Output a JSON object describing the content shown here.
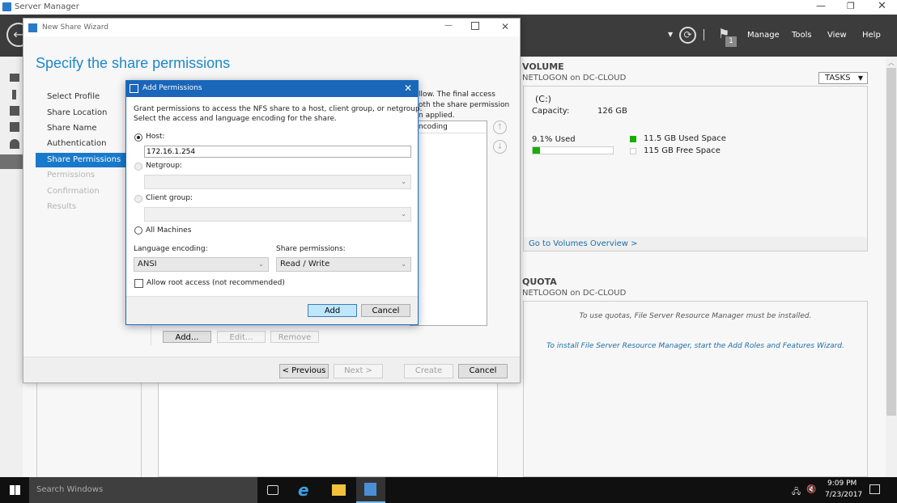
{
  "server_manager": {
    "title": "Server Manager",
    "menu": [
      "Manage",
      "Tools",
      "View",
      "Help"
    ],
    "notification_count": "1"
  },
  "volume": {
    "heading": "VOLUME",
    "subtitle": "NETLOGON on DC-CLOUD",
    "tasks_label": "TASKS",
    "drive": "(C:)",
    "capacity_label": "Capacity:",
    "capacity_value": "126 GB",
    "used_percent_label": "9.1% Used",
    "used_fraction": 0.091,
    "used_space": "11.5 GB Used Space",
    "free_space": "115 GB Free Space",
    "used_color": "#13b000",
    "overview_link": "Go to Volumes Overview >"
  },
  "quota": {
    "heading": "QUOTA",
    "subtitle": "NETLOGON on DC-CLOUD",
    "message": "To use quotas, File Server Resource Manager must be installed.",
    "install_link": "To install File Server Resource Manager, start the Add Roles and Features Wizard."
  },
  "wizard": {
    "title": "New Share Wizard",
    "heading": "Specify the share permissions",
    "steps": [
      {
        "label": "Select Profile",
        "state": "done"
      },
      {
        "label": "Share Location",
        "state": "done"
      },
      {
        "label": "Share Name",
        "state": "done"
      },
      {
        "label": "Authentication",
        "state": "done"
      },
      {
        "label": "Share Permissions",
        "state": "active"
      },
      {
        "label": "Permissions",
        "state": "disabled"
      },
      {
        "label": "Confirmation",
        "state": "disabled"
      },
      {
        "label": "Results",
        "state": "disabled"
      }
    ],
    "desc_lines": [
      "llow. The final access",
      "oth the share permission",
      "n applied."
    ],
    "table_header": "ncoding",
    "add_label": "Add...",
    "edit_label": "Edit...",
    "remove_label": "Remove",
    "previous_label": "< Previous",
    "next_label": "Next >",
    "create_label": "Create",
    "cancel_label": "Cancel"
  },
  "dialog": {
    "title": "Add Permissions",
    "description_1": "Grant permissions to access the NFS share to a host, client group, or netgroup.",
    "description_2": "Select the access and language encoding for the share.",
    "host_label": "Host:",
    "host_value": "172.16.1.254",
    "netgroup_label": "Netgroup:",
    "client_group_label": "Client group:",
    "all_machines_label": "All Machines",
    "language_label": "Language encoding:",
    "language_value": "ANSI",
    "permissions_label": "Share permissions:",
    "permissions_value": "Read / Write",
    "root_access_label": "Allow root access (not recommended)",
    "root_access_checked": false,
    "selected_option": "host",
    "add_label": "Add",
    "cancel_label": "Cancel"
  },
  "taskbar": {
    "search_placeholder": "Search Windows",
    "time": "9:09 PM",
    "date": "7/23/2017"
  }
}
